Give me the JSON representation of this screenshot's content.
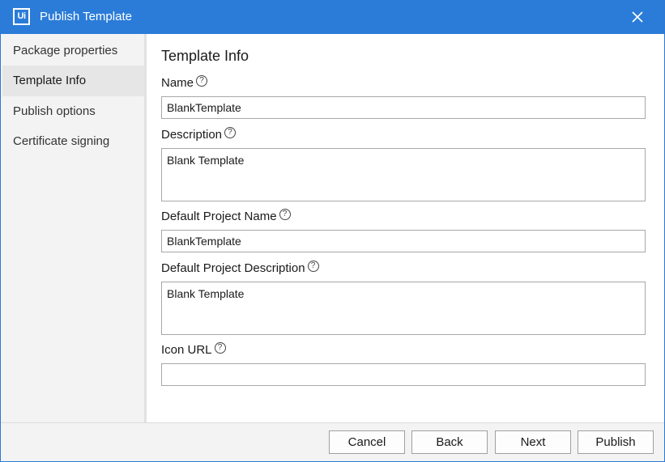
{
  "window": {
    "title": "Publish Template",
    "logo_text": "Ui"
  },
  "sidebar": {
    "items": [
      {
        "label": "Package properties"
      },
      {
        "label": "Template Info"
      },
      {
        "label": "Publish options"
      },
      {
        "label": "Certificate signing"
      }
    ],
    "active": "Template Info"
  },
  "main": {
    "heading": "Template Info",
    "fields": {
      "name": {
        "label": "Name",
        "value": "BlankTemplate"
      },
      "description": {
        "label": "Description",
        "value": "Blank Template"
      },
      "default_project_name": {
        "label": "Default Project Name",
        "value": "BlankTemplate"
      },
      "default_project_description": {
        "label": "Default Project Description",
        "value": "Blank Template"
      },
      "icon_url": {
        "label": "Icon URL",
        "value": ""
      }
    },
    "help_glyph": "?"
  },
  "footer": {
    "cancel": "Cancel",
    "back": "Back",
    "next": "Next",
    "publish": "Publish"
  },
  "colors": {
    "title_bar": "#2b7cd8",
    "sidebar_bg": "#f3f3f3",
    "active_item_bg": "#e6e6e6"
  },
  "icons": [
    "uipath-logo-icon",
    "close-icon",
    "help-icon"
  ]
}
